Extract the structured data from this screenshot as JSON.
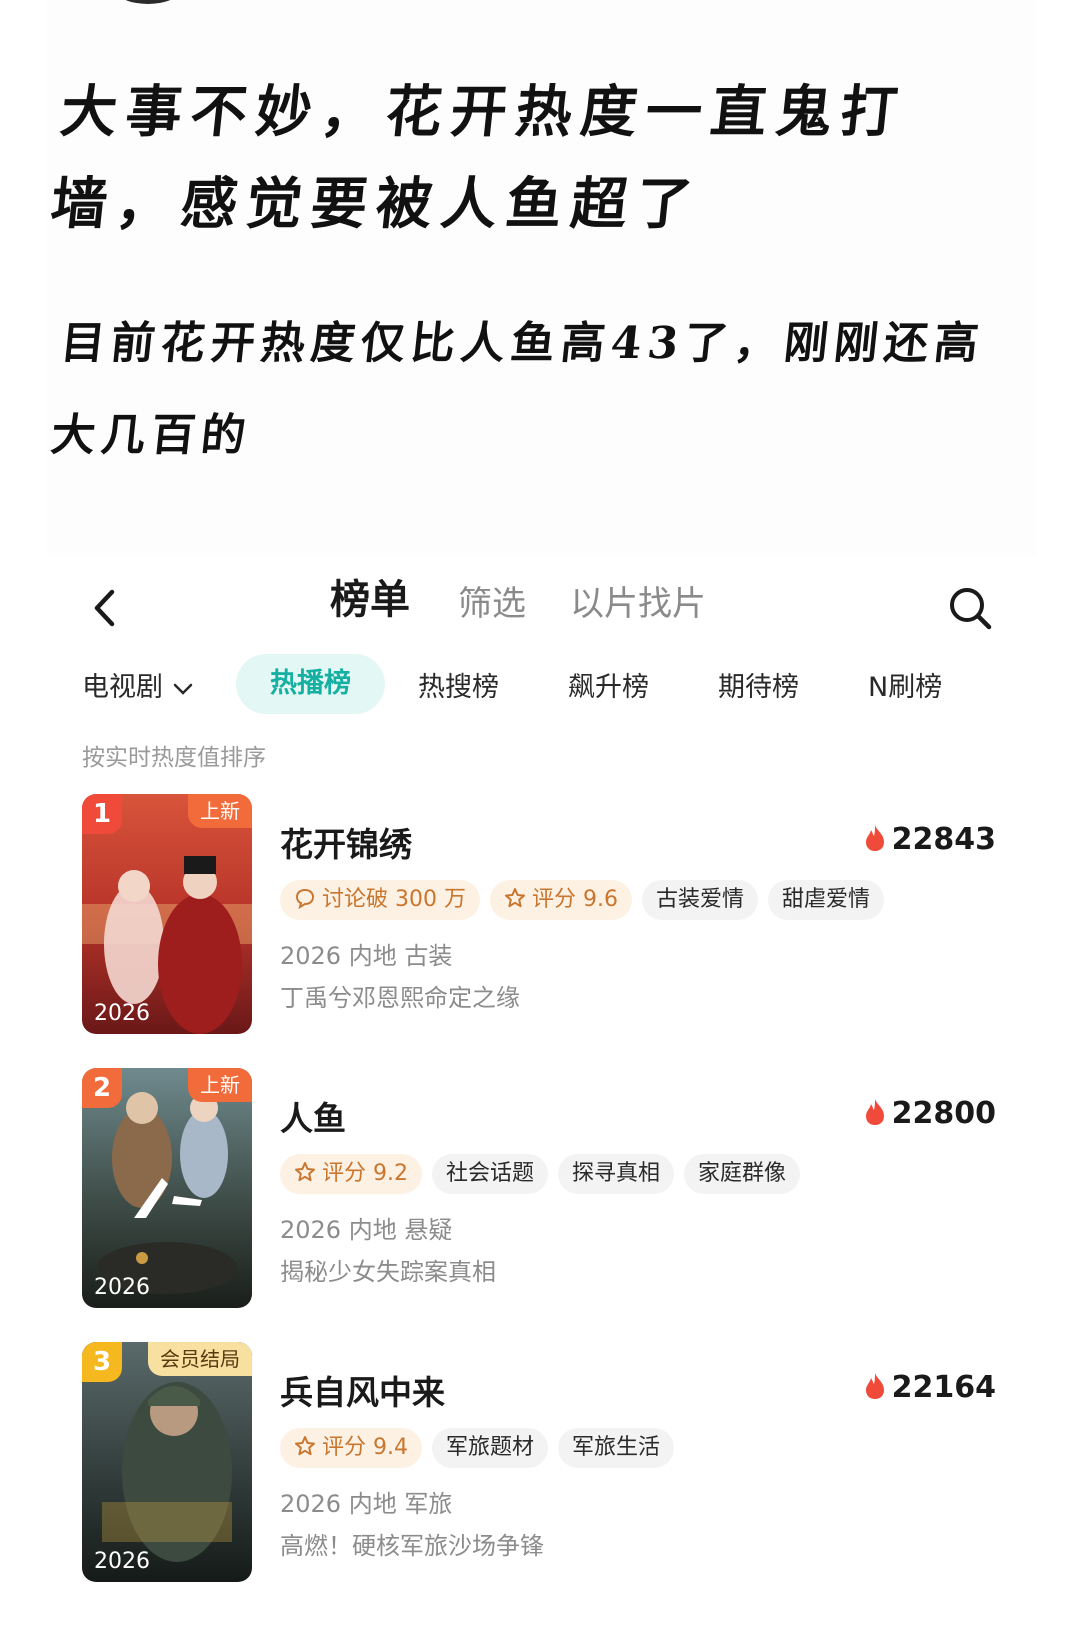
{
  "note": {
    "line1": "大事不妙，花开热度一直鬼打墙，感觉要被人鱼超了",
    "line2": "目前花开热度仅比人鱼高43了，刚刚还高大几百的"
  },
  "nav": {
    "tabs": [
      "榜单",
      "筛选",
      "以片找片"
    ]
  },
  "subnav": {
    "category": "电视剧",
    "tabs": [
      "热播榜",
      "热搜榜",
      "飙升榜",
      "期待榜",
      "N刷榜"
    ]
  },
  "sort_hint": "按实时热度值排序",
  "colors": {
    "accent": "#16b0a2",
    "flame": "#f04a3a",
    "rank1": "#f04a3a",
    "rank3": "#f6b81f"
  },
  "list": [
    {
      "rank": "1",
      "badge": "上新",
      "year": "2026",
      "title": "花开锦绣",
      "heat": "22843",
      "tags": [
        {
          "icon": "comment-icon",
          "label": "讨论破 300 万",
          "hot": true
        },
        {
          "icon": "star-icon",
          "label": "评分 9.6",
          "hot": true
        },
        {
          "label": "古装爱情"
        },
        {
          "label": "甜虐爱情"
        }
      ],
      "meta": "2026 内地 古装",
      "desc": "丁禹兮邓恩熙命定之缘"
    },
    {
      "rank": "2",
      "badge": "上新",
      "year": "2026",
      "title": "人鱼",
      "heat": "22800",
      "tags": [
        {
          "icon": "star-icon",
          "label": "评分 9.2",
          "hot": true
        },
        {
          "label": "社会话题"
        },
        {
          "label": "探寻真相"
        },
        {
          "label": "家庭群像"
        }
      ],
      "meta": "2026 内地 悬疑",
      "desc": "揭秘少女失踪案真相"
    },
    {
      "rank": "3",
      "badge": "会员结局",
      "year": "2026",
      "title": "兵自风中来",
      "heat": "22164",
      "tags": [
        {
          "icon": "star-icon",
          "label": "评分 9.4",
          "hot": true
        },
        {
          "label": "军旅题材"
        },
        {
          "label": "军旅生活"
        }
      ],
      "meta": "2026 内地 军旅",
      "desc": "高燃！硬核军旅沙场争锋"
    }
  ]
}
